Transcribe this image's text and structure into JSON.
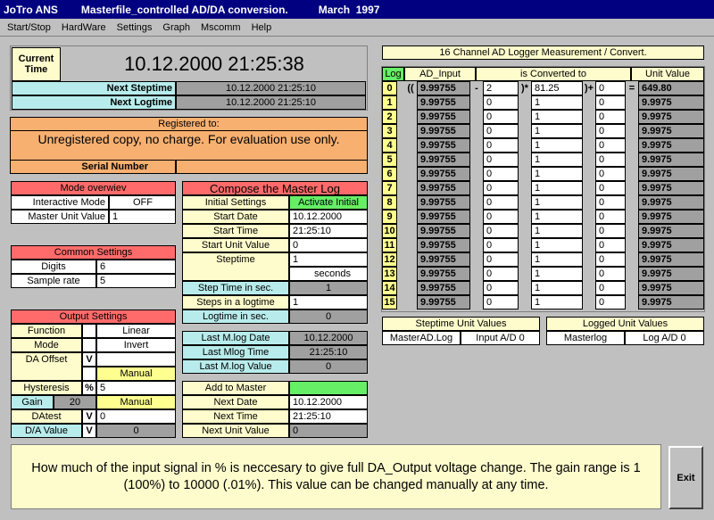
{
  "title": {
    "app": "JoTro ANS",
    "caption": "Masterfile_controlled AD/DA conversion.",
    "date": "March  1997"
  },
  "menu": [
    "Start/Stop",
    "HardWare",
    "Settings",
    "Graph",
    "Mscomm",
    "Help"
  ],
  "time": {
    "current_label": "Current Time",
    "current_value": "10.12.2000 21:25:38",
    "next_step_label": "Next Steptime",
    "next_step_value": "10.12.2000 21:25:10",
    "next_log_label": "Next Logtime",
    "next_log_value": "10.12.2000 21:25:10"
  },
  "registration": {
    "header": "Registered to:",
    "text": "Unregistered copy, no charge. For evaluation use only.",
    "serial_label": "Serial Number",
    "serial_value": ""
  },
  "mode": {
    "header": "Mode overwiev",
    "interactive_label": "Interactive Mode",
    "interactive_value": "OFF",
    "master_unit_label": "Master Unit Value",
    "master_unit_value": "1"
  },
  "common": {
    "header": "Common Settings",
    "digits_label": "Digits",
    "digits_value": "6",
    "sample_label": "Sample rate",
    "sample_value": "5"
  },
  "output": {
    "header": "Output Settings",
    "function_label": "Function",
    "function_value": "Linear",
    "mode_label": "Mode",
    "mode_value": "Invert",
    "offset_label": "DA Offset",
    "offset_unit": "V",
    "offset_value": "",
    "offset_manual": "Manual",
    "hyst_label": "Hysteresis",
    "hyst_unit": "%",
    "hyst_value": "5",
    "gain_label": "Gain",
    "gain_value": "20",
    "gain_manual": "Manual",
    "datest_label": "DAtest",
    "datest_unit": "V",
    "datest_value": "0",
    "da_label": "D/A Value",
    "da_unit": "V",
    "da_value": "0"
  },
  "compose": {
    "header": "Compose the Master Log",
    "initial_label": "Initial Settings",
    "initial_value": "Activate Initial",
    "start_date_label": "Start Date",
    "start_date_value": "10.12.2000",
    "start_time_label": "Start Time",
    "start_time_value": "21:25:10",
    "start_unit_label": "Start Unit Value",
    "start_unit_value": "0",
    "steptime_label": "Steptime",
    "steptime_value": "1",
    "steptime_unit": "seconds",
    "step_sec_label": "Step Time in sec.",
    "step_sec_value": "1",
    "steps_log_label": "Steps in a logtime",
    "steps_log_value": "1",
    "log_sec_label": "Logtime in sec.",
    "log_sec_value": "0"
  },
  "last": {
    "date_label": "Last M.log Date",
    "date_value": "10.12.2000",
    "time_label": "Last Mlog Time",
    "time_value": "21:25:10",
    "value_label": "Last M.log Value",
    "value_value": "0"
  },
  "add": {
    "label": "Add to Master",
    "value": "",
    "next_date_label": "Next Date",
    "next_date_value": "10.12.2000",
    "next_time_label": "Next Time",
    "next_time_value": "21:25:10",
    "next_unit_label": "Next Unit Value",
    "next_unit_value": "0"
  },
  "logger": {
    "title": "16 Channel AD Logger Measurement / Convert.",
    "h_log": "Log",
    "h_ad": "AD_Input",
    "h_conv": "is Converted to",
    "h_unit": "Unit Value",
    "row0": {
      "open": "((",
      "ad": "9.99755",
      "minus": "-",
      "sub": "2",
      "times": ")*",
      "mul": "81.25",
      "plus": ")+",
      "add": "0",
      "eq": "=",
      "unit": "649.80"
    },
    "rows": [
      {
        "ch": "1",
        "ad": "9.99755",
        "sub": "0",
        "mul": "1",
        "add": "0",
        "unit": "9.9975"
      },
      {
        "ch": "2",
        "ad": "9.99755",
        "sub": "0",
        "mul": "1",
        "add": "0",
        "unit": "9.9975"
      },
      {
        "ch": "3",
        "ad": "9.99755",
        "sub": "0",
        "mul": "1",
        "add": "0",
        "unit": "9.9975"
      },
      {
        "ch": "4",
        "ad": "9.99755",
        "sub": "0",
        "mul": "1",
        "add": "0",
        "unit": "9.9975"
      },
      {
        "ch": "5",
        "ad": "9.99755",
        "sub": "0",
        "mul": "1",
        "add": "0",
        "unit": "9.9975"
      },
      {
        "ch": "6",
        "ad": "9.99755",
        "sub": "0",
        "mul": "1",
        "add": "0",
        "unit": "9.9975"
      },
      {
        "ch": "7",
        "ad": "9.99755",
        "sub": "0",
        "mul": "1",
        "add": "0",
        "unit": "9.9975"
      },
      {
        "ch": "8",
        "ad": "9.99755",
        "sub": "0",
        "mul": "1",
        "add": "0",
        "unit": "9.9975"
      },
      {
        "ch": "9",
        "ad": "9.99755",
        "sub": "0",
        "mul": "1",
        "add": "0",
        "unit": "9.9975"
      },
      {
        "ch": "10",
        "ad": "9.99755",
        "sub": "0",
        "mul": "1",
        "add": "0",
        "unit": "9.9975"
      },
      {
        "ch": "11",
        "ad": "9.99755",
        "sub": "0",
        "mul": "1",
        "add": "0",
        "unit": "9.9975"
      },
      {
        "ch": "12",
        "ad": "9.99755",
        "sub": "0",
        "mul": "1",
        "add": "0",
        "unit": "9.9975"
      },
      {
        "ch": "13",
        "ad": "9.99755",
        "sub": "0",
        "mul": "1",
        "add": "0",
        "unit": "9.9975"
      },
      {
        "ch": "14",
        "ad": "9.99755",
        "sub": "0",
        "mul": "1",
        "add": "0",
        "unit": "9.9975"
      },
      {
        "ch": "15",
        "ad": "9.99755",
        "sub": "0",
        "mul": "1",
        "add": "0",
        "unit": "9.9975"
      }
    ],
    "row0_ch": "0"
  },
  "steptime_units": {
    "header": "Steptime Unit Values",
    "file": "MasterAD.Log",
    "value": "Input A/D  0"
  },
  "logged_units": {
    "header": "Logged Unit Values",
    "file": "Masterlog",
    "value": "Log A/D  0"
  },
  "help": "How much of the input signal in % is neccesary to give full DA_Output voltage change. The gain range is 1 (100%) to 10000 (.01%). This value can be changed manually at any time.",
  "exit_label": "Exit"
}
